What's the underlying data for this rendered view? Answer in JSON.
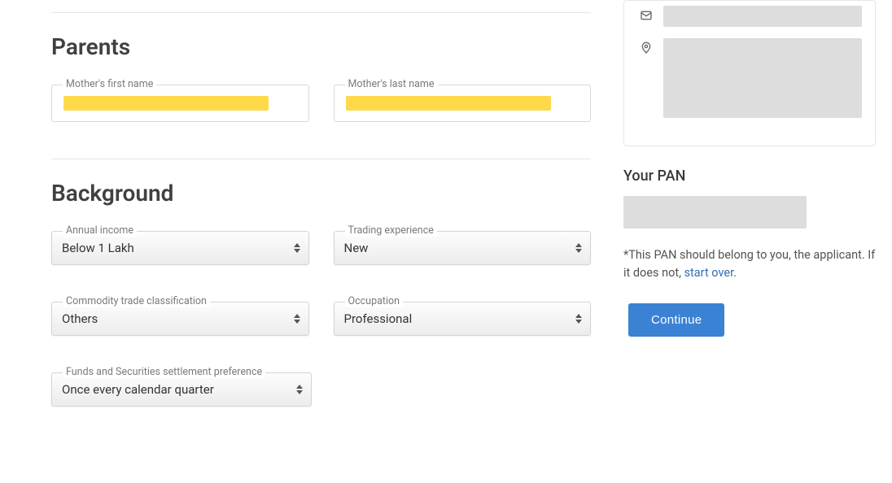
{
  "sections": {
    "parents": {
      "title": "Parents",
      "fields": {
        "mother_first": {
          "label": "Mother's first name"
        },
        "mother_last": {
          "label": "Mother's last name"
        }
      }
    },
    "background": {
      "title": "Background",
      "fields": {
        "annual_income": {
          "label": "Annual income",
          "value": "Below 1 Lakh"
        },
        "trading_experience": {
          "label": "Trading experience",
          "value": "New"
        },
        "commodity_class": {
          "label": "Commodity trade classification",
          "value": "Others"
        },
        "occupation": {
          "label": "Occupation",
          "value": "Professional"
        },
        "settlement_pref": {
          "label": "Funds and Securities settlement preference",
          "value": "Once every calendar quarter"
        }
      }
    }
  },
  "sidebar": {
    "pan": {
      "title": "Your PAN",
      "note_prefix": "*This PAN should belong to you, the applicant. If it does not, ",
      "note_link": "start over",
      "note_suffix": "."
    },
    "continue_label": "Continue"
  }
}
